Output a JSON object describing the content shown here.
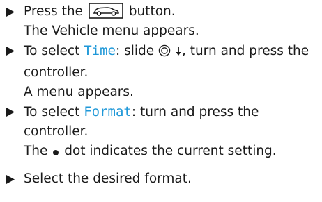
{
  "steps": [
    {
      "instruction_before": "Press the",
      "instruction_after": "button.",
      "result": "The Vehicle menu appears.",
      "icon": "vehicle-button-icon"
    },
    {
      "instruction_before": "To select",
      "keyword": "Time",
      "instruction_mid": ": slide",
      "instruction_after": ", turn and press the controller.",
      "result": "A menu appears.",
      "icons": [
        "controller-icon",
        "arrow-down-icon"
      ]
    },
    {
      "instruction_before": "To select",
      "keyword": "Format",
      "instruction_after": ": turn and press the controller.",
      "result_before": "The",
      "result_after": "dot indicates the current setting.",
      "icon": "dot-icon"
    },
    {
      "instruction": "Select the desired format."
    }
  ],
  "colors": {
    "keyword": "#1f98d8",
    "text": "#1a1a1a"
  }
}
